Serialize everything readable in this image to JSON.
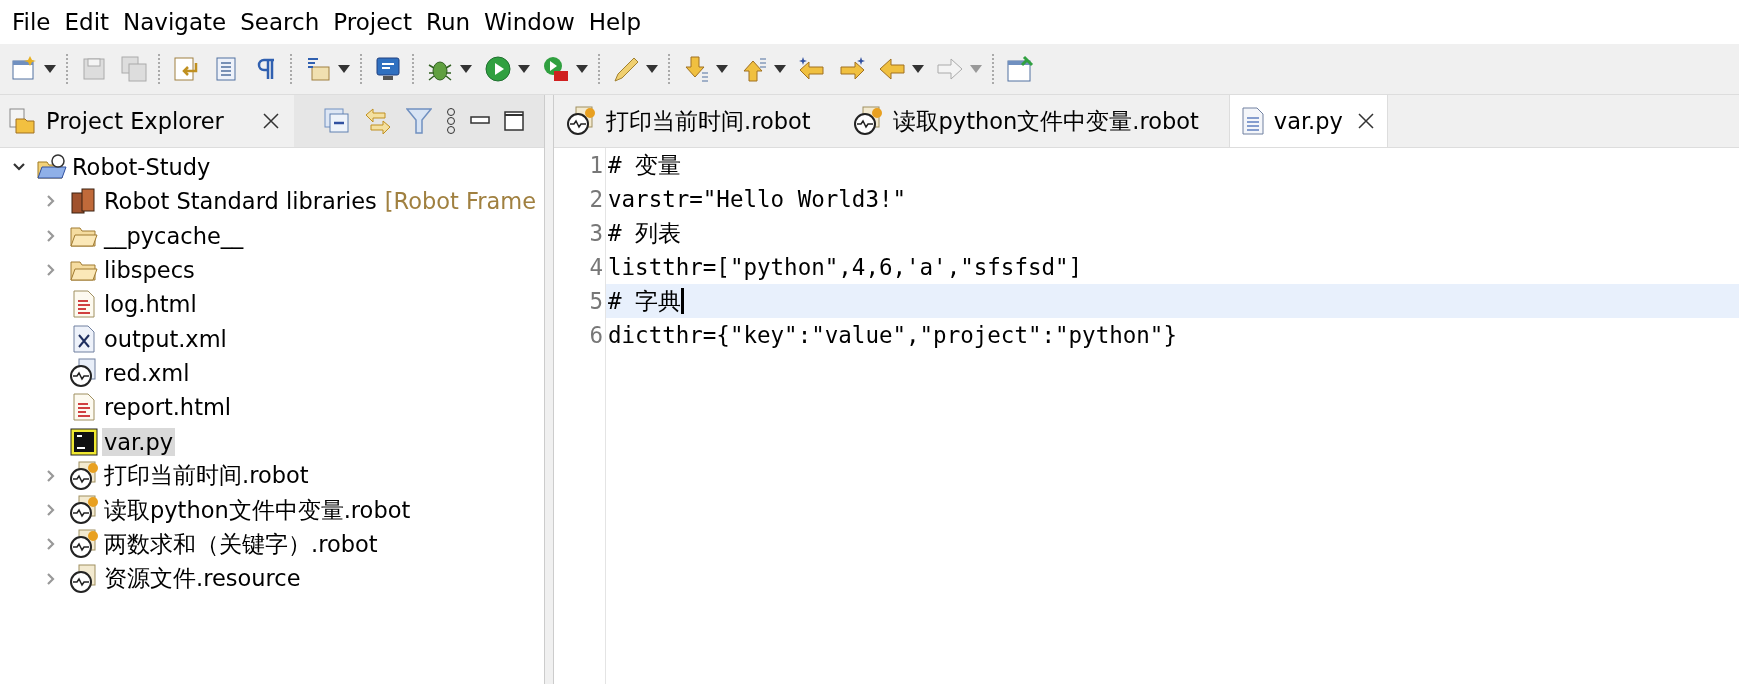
{
  "menu": [
    "File",
    "Edit",
    "Navigate",
    "Search",
    "Project",
    "Run",
    "Window",
    "Help"
  ],
  "explorer": {
    "title": "Project Explorer",
    "tree": [
      {
        "label": "Robot-Study",
        "kind": "project",
        "expanded": true,
        "selected": false,
        "children": [
          {
            "label": "Robot Standard libraries",
            "suffix": "[Robot Frame",
            "kind": "library",
            "expanded": false,
            "selected": false
          },
          {
            "label": "__pycache__",
            "kind": "folder",
            "expanded": false,
            "selected": false
          },
          {
            "label": "libspecs",
            "kind": "folder",
            "expanded": false,
            "selected": false
          },
          {
            "label": "log.html",
            "kind": "html",
            "selected": false
          },
          {
            "label": "output.xml",
            "kind": "xml",
            "selected": false
          },
          {
            "label": "red.xml",
            "kind": "robot-config",
            "selected": false
          },
          {
            "label": "report.html",
            "kind": "html",
            "selected": false
          },
          {
            "label": "var.py",
            "kind": "python",
            "selected": true
          },
          {
            "label": "打印当前时间.robot",
            "kind": "robot",
            "expanded": false,
            "selected": false
          },
          {
            "label": "读取python文件中变量.robot",
            "kind": "robot",
            "expanded": false,
            "selected": false
          },
          {
            "label": "两数求和（关键字）.robot",
            "kind": "robot",
            "expanded": false,
            "selected": false
          },
          {
            "label": "资源文件.resource",
            "kind": "resource",
            "expanded": false,
            "selected": false
          }
        ]
      }
    ]
  },
  "editor": {
    "tabs": [
      {
        "label": "打印当前时间.robot",
        "kind": "robot",
        "selected": false
      },
      {
        "label": "读取python文件中变量.robot",
        "kind": "robot",
        "selected": false
      },
      {
        "label": "var.py",
        "kind": "text",
        "selected": true
      }
    ],
    "lines": [
      {
        "number": "1",
        "text": "# 变量",
        "current": false
      },
      {
        "number": "2",
        "text": "varstr=\"Hello World3!\"",
        "current": false
      },
      {
        "number": "3",
        "text": "# 列表",
        "current": false
      },
      {
        "number": "4",
        "text": "listthr=[\"python\",4,6,'a',\"sfsfsd\"]",
        "current": false
      },
      {
        "number": "5",
        "text": "# 字典",
        "current": true
      },
      {
        "number": "6",
        "text": "dictthr={\"key\":\"value\",\"project\":\"python\"}",
        "current": false
      }
    ]
  }
}
